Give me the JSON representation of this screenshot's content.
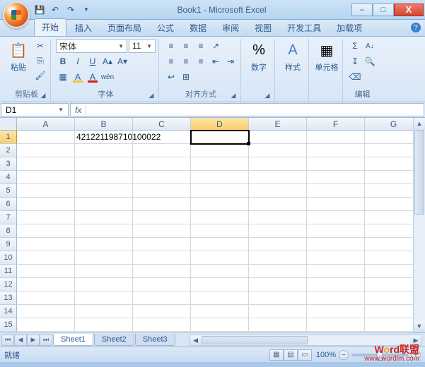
{
  "title": "Book1 - Microsoft Excel",
  "qat_icons": [
    "save-icon",
    "undo-icon",
    "redo-icon"
  ],
  "window_controls": {
    "min": "–",
    "max": "□",
    "close": "X"
  },
  "tabs": {
    "items": [
      "开始",
      "插入",
      "页面布局",
      "公式",
      "数据",
      "审阅",
      "视图",
      "开发工具",
      "加载项"
    ],
    "active": 0
  },
  "ribbon": {
    "clipboard": {
      "label": "剪贴板",
      "paste": "粘贴"
    },
    "font": {
      "label": "字体",
      "name": "宋体",
      "size": "11",
      "buttons": [
        "B",
        "I",
        "U"
      ]
    },
    "align": {
      "label": "对齐方式"
    },
    "number": {
      "label": "数字"
    },
    "styles": {
      "label": "样式"
    },
    "cells": {
      "label": "单元格"
    },
    "editing": {
      "label": "编辑"
    }
  },
  "namebox": "D1",
  "formula": "",
  "columns": [
    "A",
    "B",
    "C",
    "D",
    "E",
    "F",
    "G"
  ],
  "selected_col_index": 3,
  "rows": [
    1,
    2,
    3,
    4,
    5,
    6,
    7,
    8,
    9,
    10,
    11,
    12,
    13,
    14,
    15
  ],
  "selected_row_index": 0,
  "selected_cell": {
    "row": 0,
    "col": 3
  },
  "cell_values": {
    "B1": "421221198710100022"
  },
  "sheets": {
    "items": [
      "Sheet1",
      "Sheet2",
      "Sheet3"
    ],
    "active": 0
  },
  "status_text": "就绪",
  "zoom_label": "100%",
  "watermark": {
    "brand_prefix": "W",
    "brand_o": "o",
    "brand_rest": "rd联盟",
    "url": "www.wordlm.com"
  }
}
